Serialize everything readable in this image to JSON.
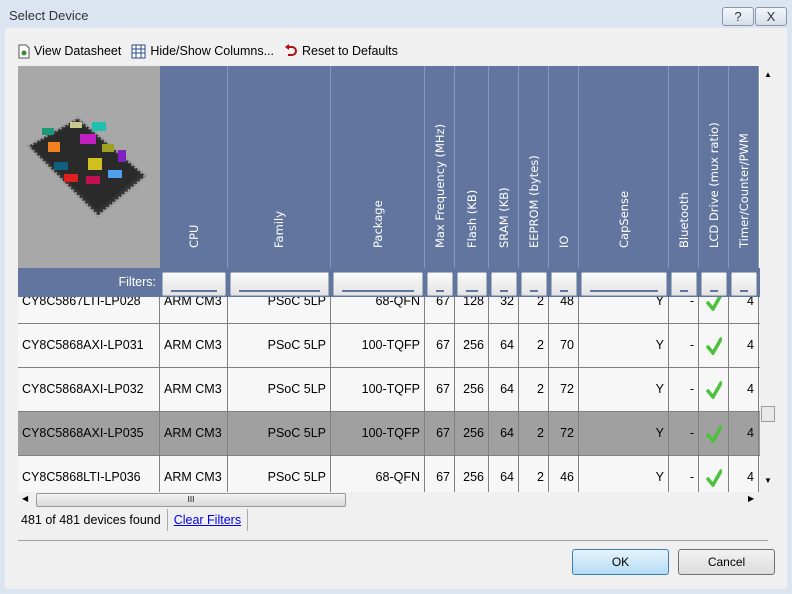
{
  "window": {
    "title": "Select Device",
    "help_button": "?",
    "close_button": "X"
  },
  "toolbar": {
    "view_datasheet": "View Datasheet",
    "hide_show_columns": "Hide/Show Columns...",
    "reset_defaults": "Reset to Defaults"
  },
  "columns": [
    "CPU",
    "Family",
    "Package",
    "Max Frequency (MHz)",
    "Flash (KB)",
    "SRAM (KB)",
    "EEPROM (bytes)",
    "IO",
    "CapSense",
    "Bluetooth",
    "LCD Drive (mux ratio)",
    "Timer/Counter/PWM"
  ],
  "filters_label": "Filters:",
  "rows": [
    {
      "part": "CY8C5867LTI-LP028",
      "cpu": "ARM CM3",
      "family": "PSoC 5LP",
      "package": "68-QFN",
      "freq": "67",
      "flash": "128",
      "sram": "32",
      "eeprom": "2",
      "io": "48",
      "capsense": "Y",
      "bluetooth": "-",
      "lcd": true,
      "timer": "4",
      "selected": false
    },
    {
      "part": "CY8C5868AXI-LP031",
      "cpu": "ARM CM3",
      "family": "PSoC 5LP",
      "package": "100-TQFP",
      "freq": "67",
      "flash": "256",
      "sram": "64",
      "eeprom": "2",
      "io": "70",
      "capsense": "Y",
      "bluetooth": "-",
      "lcd": true,
      "timer": "4",
      "selected": false
    },
    {
      "part": "CY8C5868AXI-LP032",
      "cpu": "ARM CM3",
      "family": "PSoC 5LP",
      "package": "100-TQFP",
      "freq": "67",
      "flash": "256",
      "sram": "64",
      "eeprom": "2",
      "io": "72",
      "capsense": "Y",
      "bluetooth": "-",
      "lcd": true,
      "timer": "4",
      "selected": false
    },
    {
      "part": "CY8C5868AXI-LP035",
      "cpu": "ARM CM3",
      "family": "PSoC 5LP",
      "package": "100-TQFP",
      "freq": "67",
      "flash": "256",
      "sram": "64",
      "eeprom": "2",
      "io": "72",
      "capsense": "Y",
      "bluetooth": "-",
      "lcd": true,
      "timer": "4",
      "selected": true
    },
    {
      "part": "CY8C5868LTI-LP036",
      "cpu": "ARM CM3",
      "family": "PSoC 5LP",
      "package": "68-QFN",
      "freq": "67",
      "flash": "256",
      "sram": "64",
      "eeprom": "2",
      "io": "46",
      "capsense": "Y",
      "bluetooth": "-",
      "lcd": true,
      "timer": "4",
      "selected": false
    }
  ],
  "status": {
    "count": "481 of 481 devices found",
    "clear_filters": "Clear Filters"
  },
  "buttons": {
    "ok": "OK",
    "cancel": "Cancel"
  },
  "colors": {
    "header": "#62759e",
    "selected_row": "#a0a0a0",
    "check": "#4cc23c",
    "link": "#0000ee"
  }
}
